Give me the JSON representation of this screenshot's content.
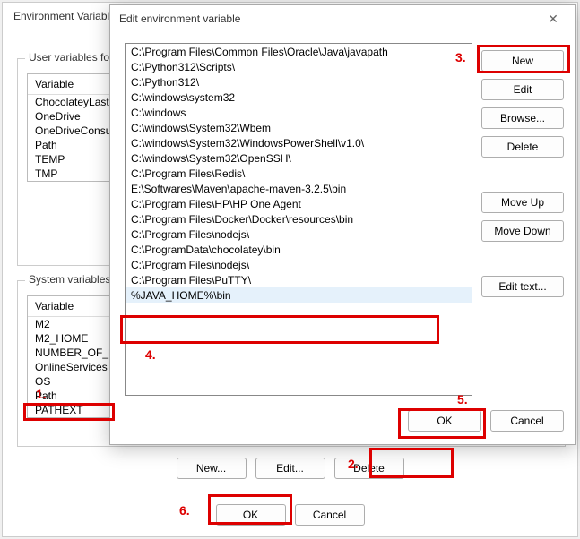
{
  "back_dialog": {
    "title": "Environment Variables",
    "user_group_label": "User variables for n",
    "sys_group_label": "System variables",
    "variable_header": "Variable",
    "user_vars": [
      "ChocolateyLastI",
      "OneDrive",
      "OneDriveConsu",
      "Path",
      "TEMP",
      "TMP"
    ],
    "sys_vars": [
      "M2",
      "M2_HOME",
      "NUMBER_OF_PR",
      "OnlineServices",
      "OS",
      "Path",
      "PATHEXT"
    ],
    "buttons": {
      "new": "New...",
      "edit": "Edit...",
      "delete": "Delete",
      "ok": "OK",
      "cancel": "Cancel"
    }
  },
  "front_dialog": {
    "title": "Edit environment variable",
    "items": [
      "C:\\Program Files\\Common Files\\Oracle\\Java\\javapath",
      "C:\\Python312\\Scripts\\",
      "C:\\Python312\\",
      "C:\\windows\\system32",
      "C:\\windows",
      "C:\\windows\\System32\\Wbem",
      "C:\\windows\\System32\\WindowsPowerShell\\v1.0\\",
      "C:\\windows\\System32\\OpenSSH\\",
      "C:\\Program Files\\Redis\\",
      "E:\\Softwares\\Maven\\apache-maven-3.2.5\\bin",
      "C:\\Program Files\\HP\\HP One Agent",
      "C:\\Program Files\\Docker\\Docker\\resources\\bin",
      "C:\\Program Files\\nodejs\\",
      "C:\\ProgramData\\chocolatey\\bin",
      "C:\\Program Files\\nodejs\\",
      "C:\\Program Files\\PuTTY\\",
      "%JAVA_HOME%\\bin"
    ],
    "selected_index": 16,
    "side_buttons": {
      "new": "New",
      "edit": "Edit",
      "browse": "Browse...",
      "delete": "Delete",
      "moveup": "Move Up",
      "movedown": "Move Down",
      "edittext": "Edit text..."
    },
    "bottom_buttons": {
      "ok": "OK",
      "cancel": "Cancel"
    }
  },
  "annotations": {
    "n1": "1.",
    "n2": "2.",
    "n3": "3.",
    "n4": "4.",
    "n5": "5.",
    "n6": "6."
  }
}
